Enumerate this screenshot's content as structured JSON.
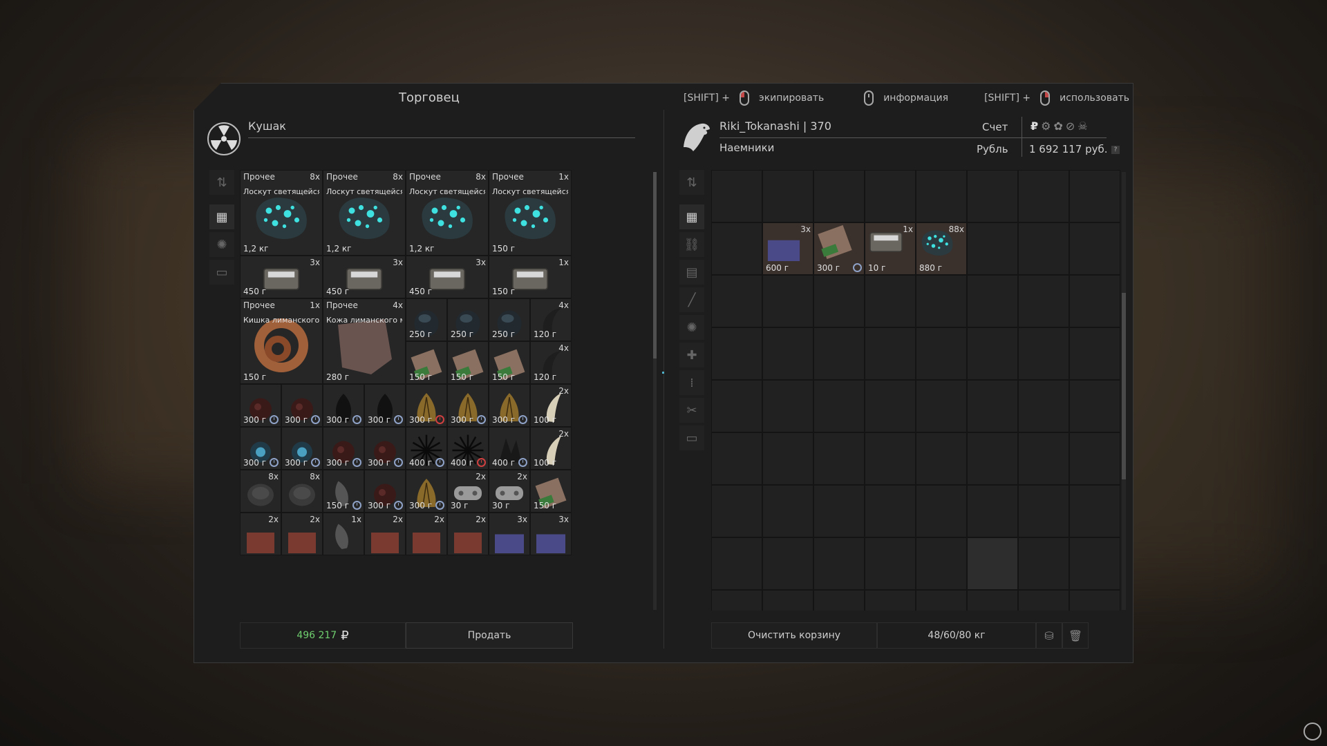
{
  "window": {
    "title": "Торговец"
  },
  "hints": [
    {
      "key": "[SHIFT] +",
      "mouse": "left",
      "label": "экипировать"
    },
    {
      "key": "",
      "mouse": "middle",
      "label": "информация"
    },
    {
      "key": "[SHIFT] +",
      "mouse": "right",
      "label": "использовать"
    }
  ],
  "trader": {
    "name": "Кушак",
    "icon": "radiation-icon",
    "total": "496 217",
    "sell_label": "Продать",
    "currency_symbol": "₽"
  },
  "player": {
    "name_level": "Riki_Tokanashi | 370",
    "faction": "Наемники",
    "account_label": "Счет",
    "currency_name": "Рубль",
    "balance": "1 692 117 руб.",
    "help": "?",
    "currency_icons": [
      "₽",
      "⚙",
      "✿",
      "⊘",
      "☠"
    ]
  },
  "trader_items": {
    "row1": [
      {
        "cat": "Прочее",
        "cnt": "8x",
        "name": "Лоскут светящейся кож...",
        "wt": "1,2 кг"
      },
      {
        "cat": "Прочее",
        "cnt": "8x",
        "name": "Лоскут светящейся кож...",
        "wt": "1,2 кг"
      },
      {
        "cat": "Прочее",
        "cnt": "8x",
        "name": "Лоскут светящейся кож...",
        "wt": "1,2 кг"
      },
      {
        "cat": "Прочее",
        "cnt": "1x",
        "name": "Лоскут светящейся кож...",
        "wt": "150 г"
      }
    ],
    "row2": [
      {
        "cnt": "3x",
        "wt": "450 г"
      },
      {
        "cnt": "3x",
        "wt": "450 г"
      },
      {
        "cnt": "3x",
        "wt": "450 г"
      },
      {
        "cnt": "1x",
        "wt": "150 г"
      }
    ],
    "big": [
      {
        "cat": "Прочее",
        "cnt": "1x",
        "name": "Кишка лиманского мут...",
        "wt": "150 г"
      },
      {
        "cat": "Прочее",
        "cnt": "4x",
        "name": "Кожа лиманского мута...",
        "wt": "280 г"
      }
    ],
    "small_a": [
      {
        "wt": "250 г"
      },
      {
        "wt": "250 г"
      },
      {
        "wt": "250 г"
      },
      {
        "wt": "120 г",
        "cnt": "4x"
      }
    ],
    "small_b": [
      {
        "wt": "150 г"
      },
      {
        "wt": "150 г"
      },
      {
        "wt": "150 г"
      },
      {
        "wt": "120 г",
        "cnt": "4x"
      }
    ],
    "row5": [
      {
        "wt": "300 г",
        "clk": "blue"
      },
      {
        "wt": "300 г",
        "clk": "blue"
      },
      {
        "wt": "300 г",
        "clk": "blue"
      },
      {
        "wt": "300 г",
        "clk": "blue"
      },
      {
        "wt": "300 г",
        "clk": "red"
      },
      {
        "wt": "300 г",
        "clk": "blue"
      },
      {
        "wt": "300 г",
        "clk": "blue"
      },
      {
        "wt": "100 г",
        "cnt": "2x"
      }
    ],
    "row6": [
      {
        "wt": "300 г",
        "clk": "blue"
      },
      {
        "wt": "300 г",
        "clk": "blue"
      },
      {
        "wt": "300 г",
        "clk": "blue"
      },
      {
        "wt": "300 г",
        "clk": "blue"
      },
      {
        "wt": "400 г",
        "clk": "blue"
      },
      {
        "wt": "400 г",
        "clk": "red"
      },
      {
        "wt": "400 г",
        "clk": "blue"
      },
      {
        "wt": "100 г",
        "cnt": "2x"
      }
    ],
    "row7": [
      {
        "cnt": "8x"
      },
      {
        "cnt": "8x"
      },
      {
        "wt": "150 г",
        "clk": "blue"
      },
      {
        "wt": "300 г",
        "clk": "blue"
      },
      {
        "wt": "300 г",
        "clk": "blue"
      },
      {
        "wt": "30 г",
        "cnt": "2x"
      },
      {
        "wt": "30 г",
        "cnt": "2x"
      },
      {
        "wt": "150 г"
      }
    ],
    "row8": [
      {
        "cnt": "2x"
      },
      {
        "cnt": "2x"
      },
      {
        "cnt": "1x"
      },
      {
        "cnt": "2x"
      },
      {
        "cnt": "2x"
      },
      {
        "cnt": "2x"
      },
      {
        "cnt": "3x"
      },
      {
        "cnt": "3x"
      }
    ]
  },
  "cart_items": [
    {
      "cnt": "3x",
      "wt": "600 г"
    },
    {
      "cnt": "",
      "wt": "300 г"
    },
    {
      "cnt": "1x",
      "wt": "10 г"
    },
    {
      "cnt": "88x",
      "wt": "880 г"
    }
  ],
  "cart": {
    "clear_label": "Очистить корзину",
    "weight": "48/60/80 кг"
  },
  "colors": {
    "accent_green": "#6fcf6f",
    "alert_red": "#d04040",
    "clock_blue": "#8fa2c8",
    "glow_cyan": "#3fe0e0"
  }
}
